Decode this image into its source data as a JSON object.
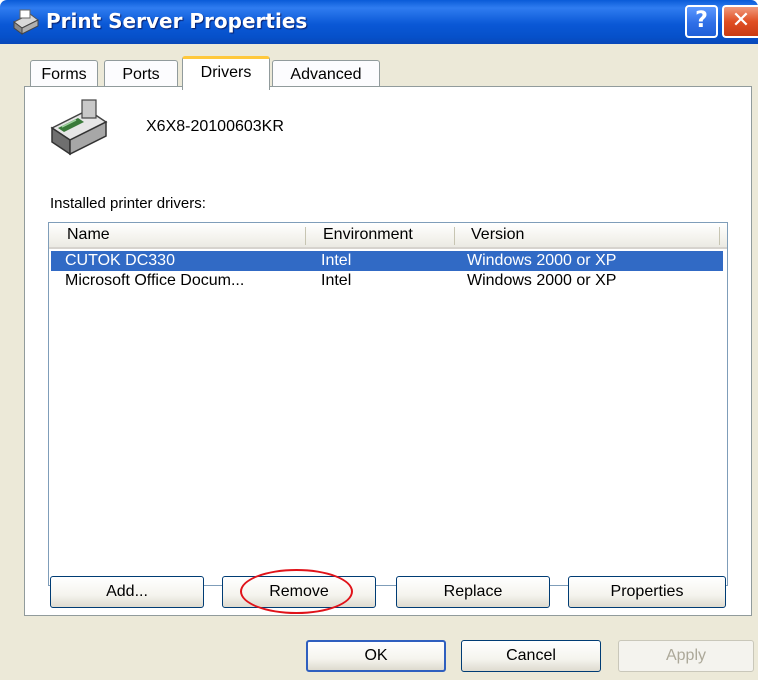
{
  "window": {
    "title": "Print Server Properties",
    "help_icon": "help-question-icon",
    "close_icon": "close-x-icon"
  },
  "tabs": [
    {
      "label": "Forms"
    },
    {
      "label": "Ports"
    },
    {
      "label": "Drivers",
      "active": true
    },
    {
      "label": "Advanced"
    }
  ],
  "server": {
    "name": "X6X8-20100603KR",
    "icon": "printer-icon"
  },
  "drivers": {
    "section_label": "Installed printer drivers:",
    "columns": [
      "Name",
      "Environment",
      "Version"
    ],
    "rows": [
      {
        "name": "CUTOK DC330",
        "environment": "Intel",
        "version": "Windows 2000 or XP",
        "selected": true
      },
      {
        "name": "Microsoft Office Docum...",
        "environment": "Intel",
        "version": "Windows 2000 or XP",
        "selected": false
      }
    ]
  },
  "driver_buttons": {
    "add": "Add...",
    "remove": "Remove",
    "replace": "Replace",
    "properties": "Properties"
  },
  "dialog_buttons": {
    "ok": "OK",
    "cancel": "Cancel",
    "apply": "Apply"
  },
  "colors": {
    "titlebar": "#0a58d6",
    "selection": "#316ac5",
    "tab_highlight": "#ffc83c",
    "annotation": "#e0131a"
  }
}
